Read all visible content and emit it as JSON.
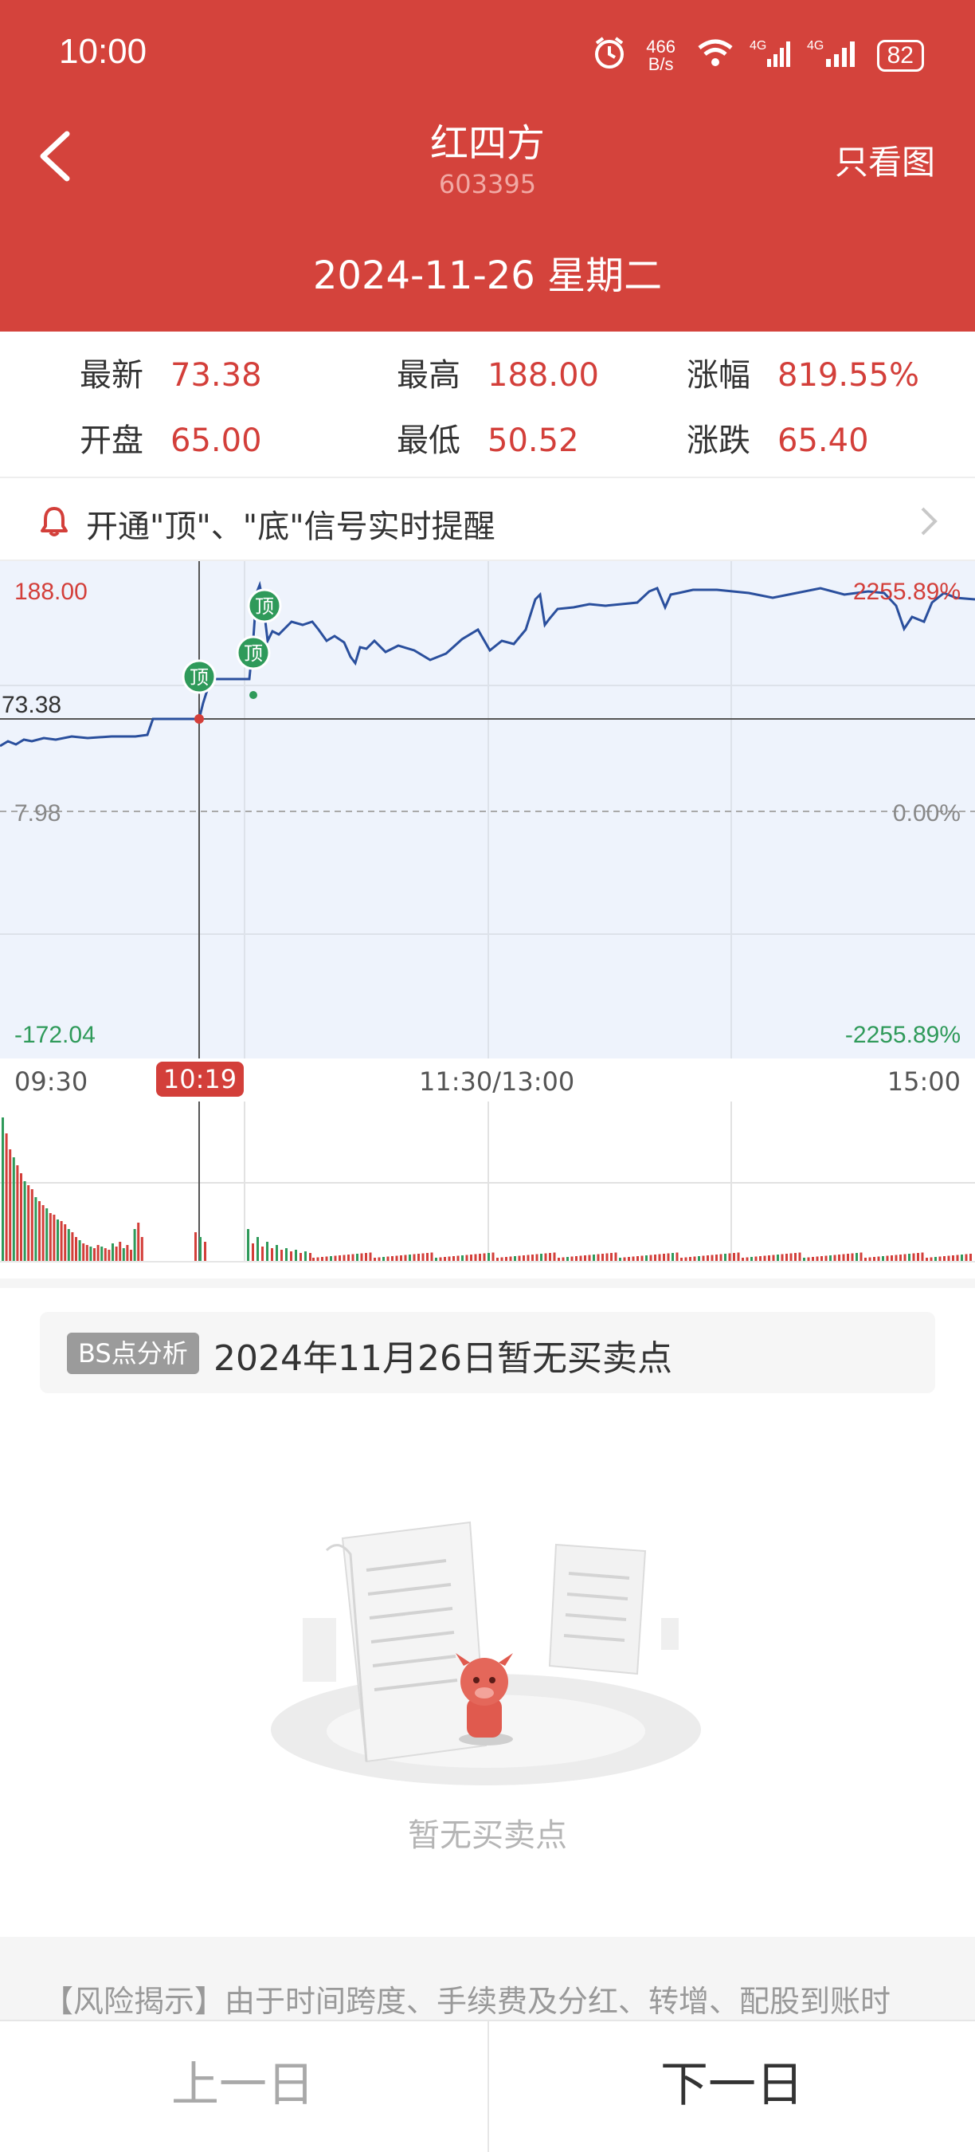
{
  "status_bar": {
    "time": "10:00",
    "net_speed": "466 B/s",
    "battery": "82"
  },
  "header": {
    "title": "红四方",
    "code": "603395",
    "view_toggle": "只看图",
    "date": "2024-11-26 星期二"
  },
  "stats": [
    {
      "label": "最新",
      "value": "73.38"
    },
    {
      "label": "最高",
      "value": "188.00"
    },
    {
      "label": "涨幅",
      "value": "819.55%"
    },
    {
      "label": "开盘",
      "value": "65.00"
    },
    {
      "label": "最低",
      "value": "50.52"
    },
    {
      "label": "涨跌",
      "value": "65.40"
    }
  ],
  "alert": {
    "text": "开通\"顶\"、\"底\"信号实时提醒"
  },
  "chart": {
    "y_top": "188.00",
    "y_mid": "7.98",
    "y_bottom": "-172.04",
    "y_current": "73.38",
    "pct_top": "2255.89%",
    "pct_mid": "0.00%",
    "pct_bottom": "-2255.89%",
    "signal_label": "顶",
    "time_labels": [
      "09:30",
      "11:30/13:00",
      "15:00"
    ],
    "cursor_time": "10:19",
    "colors": {
      "line": "#2a4f9d",
      "fill": "#eef3fc",
      "up": "#d33f3a",
      "down": "#2f9a5a"
    }
  },
  "bs": {
    "tag": "BS点分析",
    "text": "2024年11月26日暂无买卖点",
    "empty_text": "暂无买卖点"
  },
  "risk": {
    "text": "【风险揭示】由于时间跨度、手续费及分红、转增、配股到账时"
  },
  "nav": {
    "prev": "上一日",
    "next": "下一日"
  }
}
